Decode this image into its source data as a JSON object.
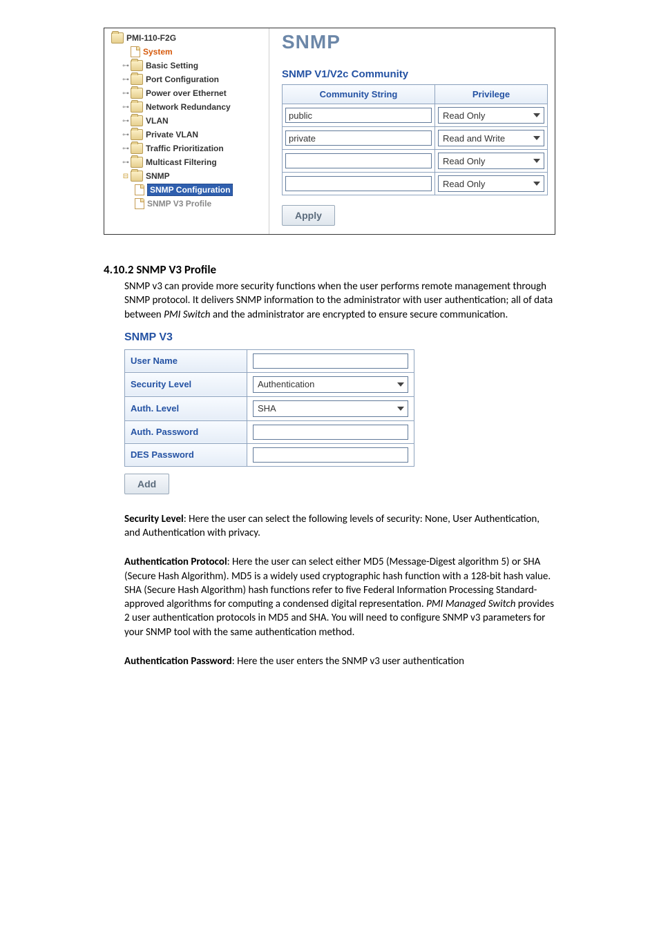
{
  "fig1": {
    "tree": {
      "root": "PMI-110-F2G",
      "system": "System",
      "items": [
        "Basic Setting",
        "Port Configuration",
        "Power over Ethernet",
        "Network Redundancy",
        "VLAN",
        "Private VLAN",
        "Traffic Prioritization",
        "Multicast Filtering",
        "SNMP"
      ],
      "snmp_children": {
        "active": "SNMP Configuration",
        "other": "SNMP V3 Profile"
      }
    },
    "title": "SNMP",
    "section": "SNMP V1/V2c Community",
    "thead": {
      "c1": "Community String",
      "c2": "Privilege"
    },
    "rows": [
      {
        "cs": "public",
        "priv": "Read Only"
      },
      {
        "cs": "private",
        "priv": "Read and Write"
      },
      {
        "cs": "",
        "priv": "Read Only"
      },
      {
        "cs": "",
        "priv": "Read Only"
      }
    ],
    "apply": "Apply"
  },
  "doc": {
    "h1": "4.10.2  SNMP V3 Profile",
    "p1": "SNMP v3 can provide more security functions when the user performs remote management through SNMP protocol. It delivers SNMP information to the administrator with user authentication; all of data between ",
    "p1i": "PMI Switch",
    "p1b": " and the administrator are encrypted to ensure secure communication.",
    "sec_lvl_b": "Security Level",
    "sec_lvl": ": Here the user can select the following levels of security: None, User Authentication, and Authentication with privacy.",
    "auth_proto_b": "Authentication Protocol",
    "auth_proto_1": ": Here the user can select either MD5 (Message-Digest algorithm 5) or SHA (Secure Hash Algorithm). MD5 is a widely used cryptographic hash function with a 128-bit hash value. SHA (Secure Hash Algorithm) hash functions refer to five Federal Information Processing Standard-approved algorithms for computing a condensed digital representation. ",
    "auth_proto_i": "PMI Managed Switch",
    "auth_proto_2": " provides 2 user authentication protocols in MD5 and SHA. You will need to configure SNMP v3 parameters for your SNMP tool with the same authentication method.",
    "auth_pw_b": "Authentication Password",
    "auth_pw": ": Here the user enters the SNMP v3 user authentication"
  },
  "v3": {
    "title": "SNMP V3",
    "rows": {
      "user": "User Name",
      "sec": "Security Level",
      "sec_val": "Authentication",
      "authl": "Auth. Level",
      "authl_val": "SHA",
      "authp": "Auth. Password",
      "desp": "DES Password"
    },
    "add": "Add"
  }
}
